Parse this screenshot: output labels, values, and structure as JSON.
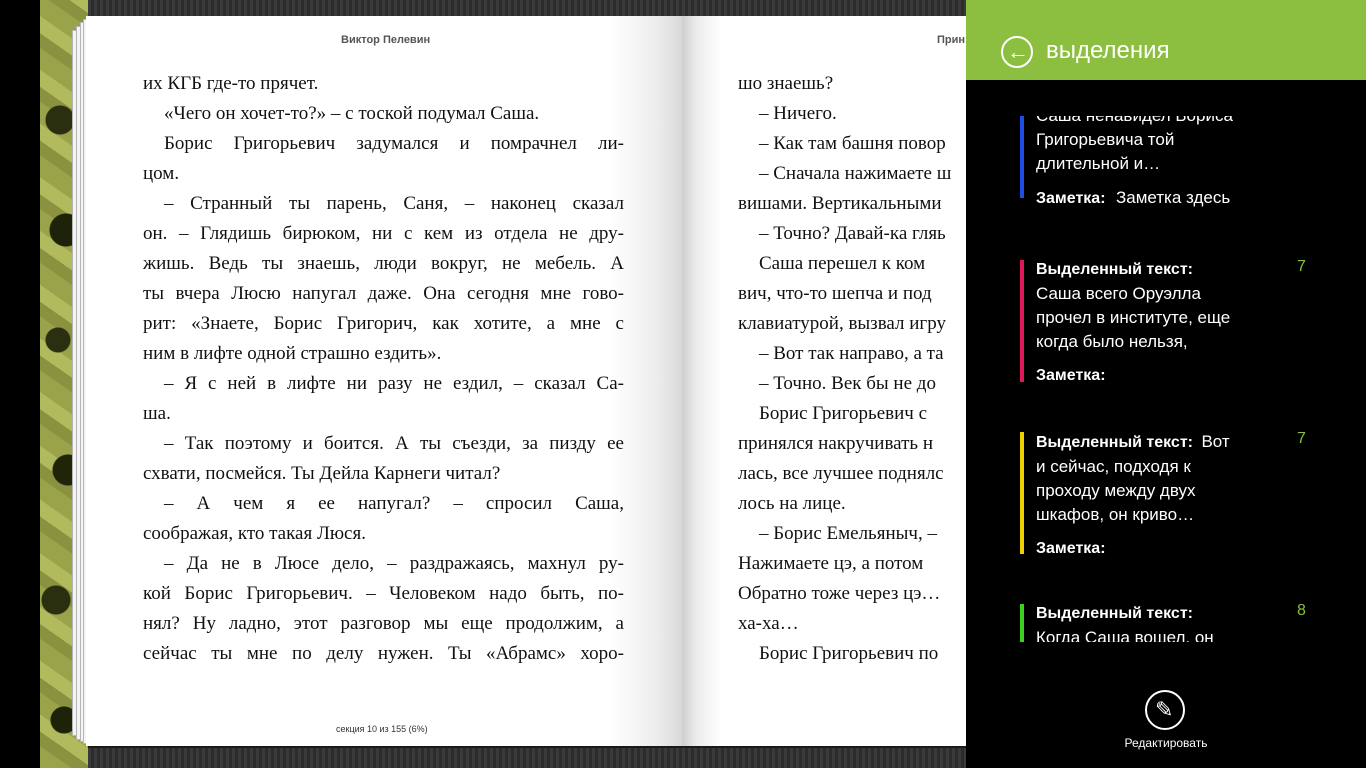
{
  "book": {
    "left_header": "Виктор Пелевин",
    "right_header": "Прин",
    "footer": "секция 10 из 155 (6%)",
    "left_lines": [
      "их КГБ где-то прячет.",
      "«Чего он хочет-то?» – с тоской подумал Саша.",
      "Борис  Григорьевич  задумался  и  помрачнел  ли-",
      "цом.",
      "–  Странный  ты  парень,  Саня, –  наконец  сказал",
      "он. –  Глядишь  бирюком,  ни  с  кем  из  отдела  не  дру-",
      "жишь.  Ведь  ты  знаешь,  люди  вокруг,  не  мебель.  А",
      "ты  вчера  Люсю  напугал  даже.  Она  сегодня  мне  гово-",
      "рит:  «Знаете,  Борис  Григорич,  как  хотите,  а  мне  с",
      "ним в лифте одной страшно ездить».",
      "–  Я  с  ней  в  лифте  ни  разу  не  ездил, –  сказал  Са-",
      "ша.",
      "–  Так  поэтому  и  боится.  А  ты  съезди,  за  пизду  ее",
      "схвати, посмейся. Ты Дейла Карнеги читал?",
      "–   А   чем   я   ее   напугал? –   спросил   Саша,",
      "соображая, кто такая Люся.",
      "–  Да  не  в  Люсе  дело, –  раздражаясь,  махнул  ру-",
      "кой  Борис  Григорьевич. –  Человеком  надо  быть,  по-",
      "нял?  Ну  ладно,  этот  разговор  мы  еще  продолжим,  а",
      "сейчас  ты  мне  по  делу  нужен.  Ты  «Абрамс»  хоро-"
    ],
    "right_lines": [
      "шо знаешь?",
      "– Ничего.",
      "– Как там башня повор",
      "– Сначала нажимаете ш",
      "вишами. Вертикальными",
      "– Точно? Давай-ка гляь",
      "Саша  перешел  к  ком",
      "вич,  что-то  шепча  и  под",
      "клавиатурой,  вызвал  игру",
      "– Вот так направо, а та",
      "– Точно. Век бы не до",
      "Борис  Григорьевич  с",
      "принялся  накручивать  н",
      "лась,  все лучшее поднялс",
      "лось на лице.",
      "–  Борис Емельяныч, –",
      "Нажимаете  цэ,  а  потом",
      "Обратно  тоже через цэ…",
      "ха-ха…",
      "Борис  Григорьевич  по"
    ]
  },
  "panel": {
    "title": "выделения",
    "back_icon": "back-arrow-icon",
    "edit_icon": "pencil-icon",
    "edit_label": "Редактировать",
    "highlight_label": "Выделенный текст:",
    "note_label": "Заметка:",
    "items": [
      {
        "color": "#1f4fe0",
        "page": "",
        "text_lines": [
          "Саша ненавидел Бориса",
          "Григорьевича той",
          "длительной и…"
        ],
        "note": "Заметка здесь"
      },
      {
        "color": "#e0185a",
        "page": "7",
        "text_lines": [
          "Саша всего Оруэлла",
          "прочел в институте, еще",
          "когда было нельзя,"
        ],
        "note": ""
      },
      {
        "color": "#f0d000",
        "page": "7",
        "first_inline": "Вот",
        "text_lines": [
          "и сейчас, подходя к",
          "проходу между двух",
          "шкафов, он криво…"
        ],
        "note": ""
      },
      {
        "color": "#3cd020",
        "page": "8",
        "text_lines": [
          "Когда Саша вошел, он"
        ],
        "note": ""
      }
    ]
  }
}
